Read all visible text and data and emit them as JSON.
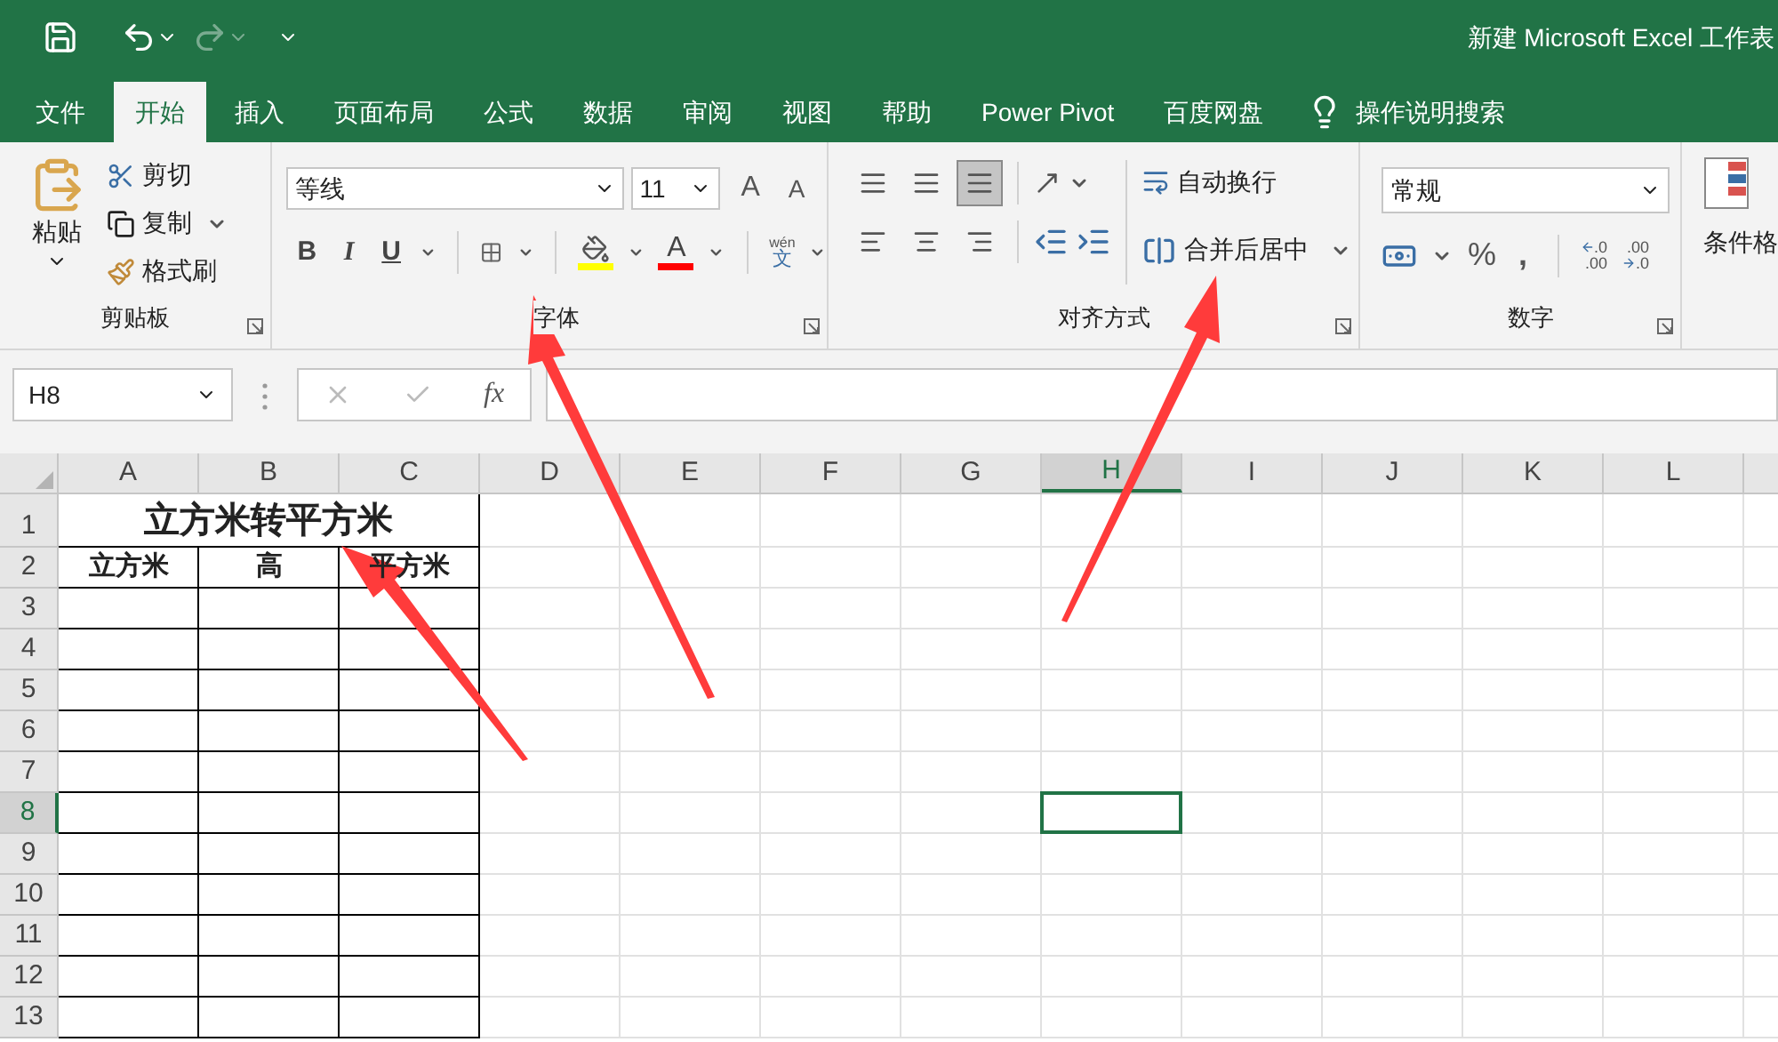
{
  "window": {
    "title": "新建 Microsoft Excel 工作表"
  },
  "tabs": [
    {
      "label": "文件",
      "selected": false
    },
    {
      "label": "开始",
      "selected": true
    },
    {
      "label": "插入",
      "selected": false
    },
    {
      "label": "页面布局",
      "selected": false
    },
    {
      "label": "公式",
      "selected": false
    },
    {
      "label": "数据",
      "selected": false
    },
    {
      "label": "审阅",
      "selected": false
    },
    {
      "label": "视图",
      "selected": false
    },
    {
      "label": "帮助",
      "selected": false
    },
    {
      "label": "Power Pivot",
      "selected": false
    },
    {
      "label": "百度网盘",
      "selected": false
    }
  ],
  "tell_me": "操作说明搜索",
  "ribbon": {
    "clipboard": {
      "label": "剪贴板",
      "paste": "粘贴",
      "cut": "剪切",
      "copy": "复制",
      "painter": "格式刷"
    },
    "font": {
      "label": "字体",
      "font_name": "等线",
      "font_size": "11",
      "grow": "A",
      "shrink": "A",
      "styles": [
        "B",
        "I",
        "U"
      ],
      "font_color": {
        "glyph": "A"
      },
      "phonetic": {
        "top": "wén",
        "bottom": "文"
      }
    },
    "alignment": {
      "label": "对齐方式",
      "vertical": [
        {
          "selected": false
        },
        {
          "selected": false
        },
        {
          "selected": true
        }
      ],
      "wrap": "自动换行",
      "merge": "合并后居中"
    },
    "number": {
      "label": "数字",
      "format": "常规",
      "percent": "%",
      "comma": ",",
      "decimals": [
        {
          "top": ".0",
          "bottom": ".00"
        },
        {
          "top": ".00",
          "bottom": ".0"
        }
      ]
    },
    "styles": {
      "conditional": "条件格"
    }
  },
  "formula_bar": {
    "name_box": "H8",
    "fx": "fx"
  },
  "sheet": {
    "columns": [
      {
        "label": "A",
        "selected": false
      },
      {
        "label": "B",
        "selected": false
      },
      {
        "label": "C",
        "selected": false
      },
      {
        "label": "D",
        "selected": false
      },
      {
        "label": "E",
        "selected": false
      },
      {
        "label": "F",
        "selected": false
      },
      {
        "label": "G",
        "selected": false
      },
      {
        "label": "H",
        "selected": true
      },
      {
        "label": "I",
        "selected": false
      },
      {
        "label": "J",
        "selected": false
      },
      {
        "label": "K",
        "selected": false
      },
      {
        "label": "L",
        "selected": false
      }
    ],
    "rows": [
      {
        "label": "1",
        "selected": false,
        "cells": [
          {
            "text": "立方米转平方米",
            "kind": "merged"
          }
        ]
      },
      {
        "label": "2",
        "selected": false,
        "cells": [
          {
            "text": "立方米",
            "kind": "cell"
          },
          {
            "text": "高",
            "kind": "cell"
          },
          {
            "text": "平方米",
            "kind": "cell"
          }
        ]
      },
      {
        "label": "3",
        "selected": false
      },
      {
        "label": "4",
        "selected": false
      },
      {
        "label": "5",
        "selected": false
      },
      {
        "label": "6",
        "selected": false
      },
      {
        "label": "7",
        "selected": false
      },
      {
        "label": "8",
        "selected": true
      },
      {
        "label": "9",
        "selected": false
      },
      {
        "label": "10",
        "selected": false
      },
      {
        "label": "11",
        "selected": false
      },
      {
        "label": "12",
        "selected": false
      },
      {
        "label": "13",
        "selected": false
      }
    ]
  }
}
